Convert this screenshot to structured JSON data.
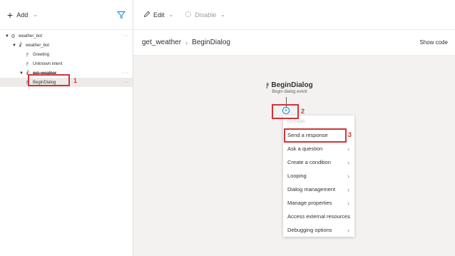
{
  "sidebar": {
    "add_label": "Add",
    "tree": [
      {
        "label": "weather_bot",
        "level": 0
      },
      {
        "label": "weather_bot",
        "level": 1
      },
      {
        "label": "Greeting",
        "level": 2
      },
      {
        "label": "Unknown intent",
        "level": 2
      },
      {
        "label": "get_weather",
        "level": 1
      },
      {
        "label": "BeginDialog",
        "level": 2
      }
    ]
  },
  "toolbar": {
    "edit_label": "Edit",
    "disable_label": "Disable"
  },
  "header": {
    "crumb_dialog": "get_weather",
    "crumb_trigger": "BeginDialog",
    "show_code": "Show code"
  },
  "canvas": {
    "trigger_title": "BeginDialog",
    "trigger_subtitle": "Begin dialog event"
  },
  "menu": {
    "hint": "(2) Fields",
    "items": [
      "Send a response",
      "Ask a question",
      "Create a condition",
      "Looping",
      "Dialog management",
      "Manage properties",
      "Access external resources",
      "Debugging options"
    ]
  },
  "annotations": {
    "step1": "1",
    "step2": "2",
    "step3": "3"
  },
  "colors": {
    "highlight": "#d13438",
    "accent": "#0078d4",
    "canvas": "#f3f2f1"
  }
}
